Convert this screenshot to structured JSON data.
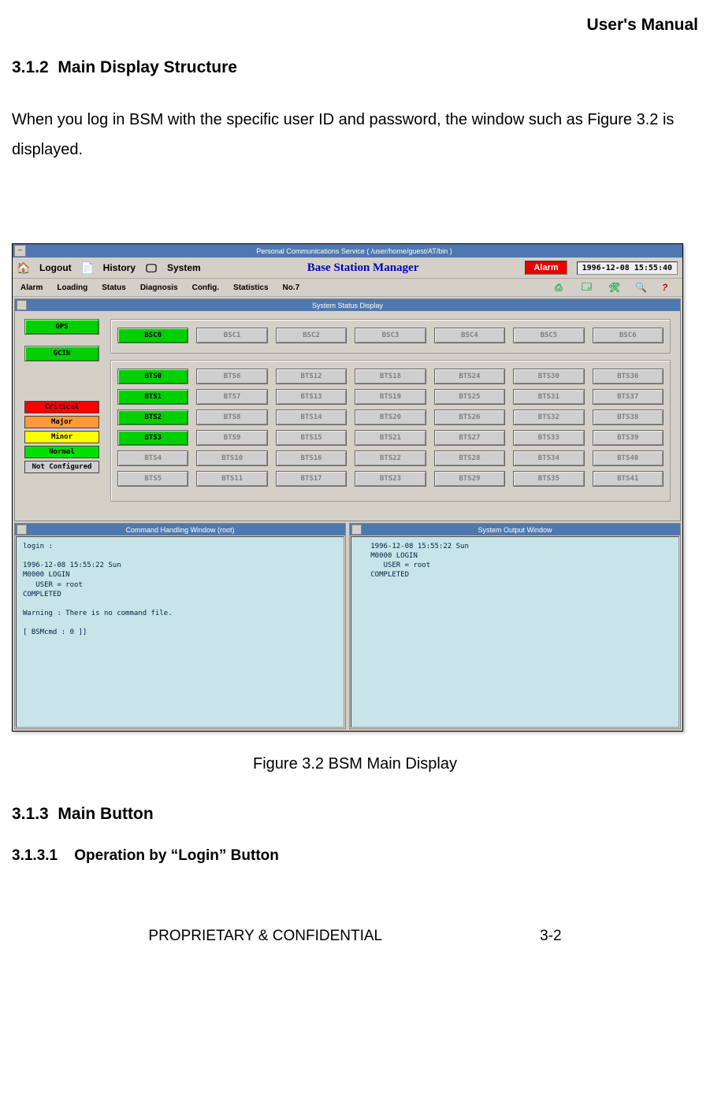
{
  "page_header": "User's Manual",
  "section_312_num": "3.1.2",
  "section_312_title": "Main Display Structure",
  "body_p1": "When you log in BSM with the specific user ID and password, the window such as Figure 3.2 is displayed.",
  "figure_caption": "Figure 3.2 BSM Main Display",
  "section_313_num": "3.1.3",
  "section_313_title": "Main Button",
  "section_3131_num": "3.1.3.1",
  "section_3131_title": "Operation by “Login” Button",
  "footer_left": "PROPRIETARY & CONFIDENTIAL",
  "footer_right": "3-2",
  "app": {
    "window_title": "Personal Communications Service ( /user/home/guest/AT/bin )",
    "tb": {
      "logout": "Logout",
      "history": "History",
      "system": "System",
      "title": "Base Station Manager",
      "alarm": "Alarm",
      "clock": "1996-12-08 15:55:40"
    },
    "menu": {
      "m0": "Alarm",
      "m1": "Loading",
      "m2": "Status",
      "m3": "Diagnosis",
      "m4": "Config.",
      "m5": "Statistics",
      "m6": "No.7"
    },
    "status_title": "System Status Display",
    "left": {
      "gps": "GPS",
      "gcin": "GCIN"
    },
    "legend": {
      "crit": "Critical",
      "maj": "Major",
      "min": "Minor",
      "norm": "Normal",
      "nc": "Not Configured"
    },
    "bsc": {
      "c0": "BSC0",
      "c1": "BSC1",
      "c2": "BSC2",
      "c3": "BSC3",
      "c4": "BSC4",
      "c5": "BSC5",
      "c6": "BSC6"
    },
    "bts": {
      "r0c0": "BTS0",
      "r0c1": "BTS6",
      "r0c2": "BTS12",
      "r0c3": "BTS18",
      "r0c4": "BTS24",
      "r0c5": "BTS30",
      "r0c6": "BTS36",
      "r1c0": "BTS1",
      "r1c1": "BTS7",
      "r1c2": "BTS13",
      "r1c3": "BTS19",
      "r1c4": "BTS25",
      "r1c5": "BTS31",
      "r1c6": "BTS37",
      "r2c0": "BTS2",
      "r2c1": "BTS8",
      "r2c2": "BTS14",
      "r2c3": "BTS20",
      "r2c4": "BTS26",
      "r2c5": "BTS32",
      "r2c6": "BTS38",
      "r3c0": "BTS3",
      "r3c1": "BTS9",
      "r3c2": "BTS15",
      "r3c3": "BTS21",
      "r3c4": "BTS27",
      "r3c5": "BTS33",
      "r3c6": "BTS39",
      "r4c0": "BTS4",
      "r4c1": "BTS10",
      "r4c2": "BTS16",
      "r4c3": "BTS22",
      "r4c4": "BTS28",
      "r4c5": "BTS34",
      "r4c6": "BTS40",
      "r5c0": "BTS5",
      "r5c1": "BTS11",
      "r5c2": "BTS17",
      "r5c3": "BTS23",
      "r5c4": "BTS29",
      "r5c5": "BTS35",
      "r5c6": "BTS41"
    },
    "cmd_title": "Command Handling Window (root)",
    "out_title": "System Output Window",
    "cmd_text": "login :\n\n1996-12-08 15:55:22 Sun\nM0000 LOGIN\n   USER = root\nCOMPLETED\n\nWarning : There is no command file.\n\n[ BSMcmd : 0 ]]",
    "out_text": "   1996-12-08 15:55:22 Sun\n   M0000 LOGIN\n      USER = root\n   COMPLETED"
  }
}
